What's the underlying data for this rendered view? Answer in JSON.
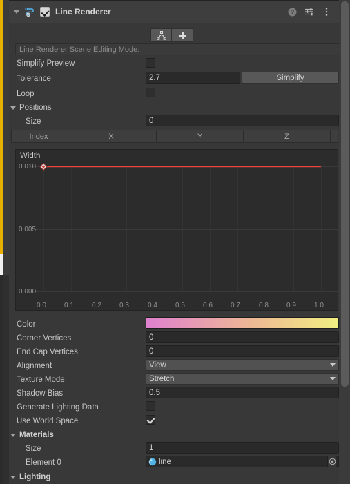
{
  "header": {
    "component_title": "Line Renderer",
    "enabled_checkbox": true,
    "foldout_expanded": true,
    "icons": {
      "component": "line-renderer-icon",
      "help": "help-icon",
      "preset": "preset-settings-icon",
      "menu": "kebab-menu-icon"
    }
  },
  "edit_tools": {
    "edit_points_label": "edit-points-icon",
    "add_point_label": "plus-icon",
    "scene_mode_text": "Line Renderer Scene Editing Mode:"
  },
  "properties": {
    "simplify_preview": {
      "label": "Simplify Preview",
      "checked": false
    },
    "tolerance": {
      "label": "Tolerance",
      "value": "2.7",
      "button": "Simplify"
    },
    "loop": {
      "label": "Loop",
      "checked": false
    }
  },
  "positions": {
    "section_label": "Positions",
    "expanded": true,
    "size": {
      "label": "Size",
      "value": "0"
    },
    "columns": [
      "Index",
      "X",
      "Y",
      "Z"
    ],
    "rows": []
  },
  "width_curve": {
    "title": "Width",
    "y_ticks": [
      "0.010",
      "0.005",
      "0.000"
    ],
    "x_ticks": [
      "0.0",
      "0.1",
      "0.2",
      "0.3",
      "0.4",
      "0.5",
      "0.6",
      "0.7",
      "0.8",
      "0.9",
      "1.0"
    ],
    "curve_color": "#e8453c",
    "keyframe_value": "0.010"
  },
  "chart_data": {
    "type": "line",
    "title": "Width",
    "xlabel": "",
    "ylabel": "",
    "xlim": [
      0.0,
      1.0
    ],
    "ylim": [
      0.0,
      0.0115
    ],
    "x": [
      0.0,
      1.0
    ],
    "values": [
      0.01,
      0.01
    ],
    "series": [
      {
        "name": "Width",
        "values": [
          0.01,
          0.01
        ],
        "color": "#e8453c"
      }
    ],
    "categories": [
      "0.0",
      "0.1",
      "0.2",
      "0.3",
      "0.4",
      "0.5",
      "0.6",
      "0.7",
      "0.8",
      "0.9",
      "1.0"
    ],
    "ytick_values": [
      0.0,
      0.005,
      0.01
    ],
    "ytick_labels": [
      "0.000",
      "0.005",
      "0.010"
    ],
    "keyframes": [
      {
        "time": 0.0,
        "value": 0.01
      }
    ],
    "grid": true,
    "legend": "none"
  },
  "appearance": {
    "color": {
      "label": "Color",
      "gradient_start": "#e081cf",
      "gradient_mid": "#edb894",
      "gradient_end": "#f1ef82"
    },
    "corner_vertices": {
      "label": "Corner Vertices",
      "value": "0"
    },
    "end_cap_vertices": {
      "label": "End Cap Vertices",
      "value": "0"
    },
    "alignment": {
      "label": "Alignment",
      "value": "View"
    },
    "texture_mode": {
      "label": "Texture Mode",
      "value": "Stretch"
    },
    "shadow_bias": {
      "label": "Shadow Bias",
      "value": "0.5"
    },
    "generate_lighting_data": {
      "label": "Generate Lighting Data",
      "checked": false
    },
    "use_world_space": {
      "label": "Use World Space",
      "checked": true
    }
  },
  "materials": {
    "section_label": "Materials",
    "expanded": true,
    "size": {
      "label": "Size",
      "value": "1"
    },
    "element0": {
      "label": "Element 0",
      "value": "line"
    }
  },
  "lighting": {
    "section_label": "Lighting",
    "expanded": true
  }
}
